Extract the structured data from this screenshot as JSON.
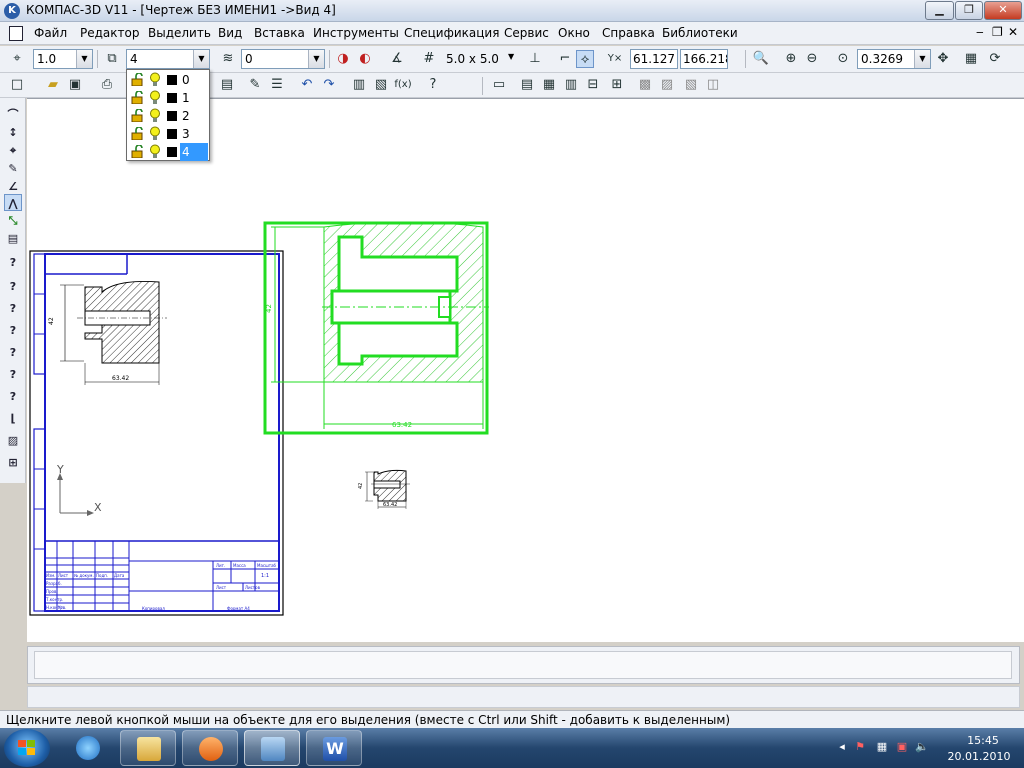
{
  "window": {
    "title": "КОМПАС-3D V11 - [Чертеж БЕЗ ИМЕНИ1 ->Вид 4]",
    "app_icon_letter": "K",
    "min_glyph": "▁",
    "max_glyph": "❐",
    "close_glyph": "✕"
  },
  "menu": {
    "items": [
      "Файл",
      "Редактор",
      "Выделить",
      "Вид",
      "Вставка",
      "Инструменты",
      "Спецификация",
      "Сервис",
      "Окно",
      "Справка",
      "Библиотеки"
    ],
    "mdi_minimize": "‒",
    "mdi_restore": "❐",
    "mdi_close": "✕"
  },
  "toolbar1": {
    "line_scale": "1.0",
    "current_layer": "4",
    "style_value": "0",
    "grid_step": "5.0 x 5.0",
    "coord_x": "61.127",
    "coord_y": "166.218",
    "zoom": "0.3269"
  },
  "layer_dropdown": {
    "layers": [
      {
        "num": "0",
        "selected": false
      },
      {
        "num": "1",
        "selected": false
      },
      {
        "num": "2",
        "selected": false
      },
      {
        "num": "3",
        "selected": false
      },
      {
        "num": "4",
        "selected": true
      }
    ]
  },
  "drawing": {
    "dim_width_label": "63.42",
    "dim_height_label": "42",
    "axis_x": "X",
    "axis_y": "Y",
    "view_dim_width": "63.42",
    "view_dim_height": "42",
    "small_dim_width": "63.42",
    "small_dim_height": "42",
    "stamp_texts": [
      "Изм.",
      "Лист",
      "№ докум.",
      "Подп.",
      "Дата",
      "Разраб.",
      "Пров.",
      "Т.контр.",
      "Н.контр.",
      "Утв.",
      "Лит.",
      "Масса",
      "Масштаб",
      "Лист",
      "Листов",
      "1:1",
      "Копировал",
      "Формат A4"
    ]
  },
  "status": {
    "hint": "Щелкните левой кнопкой мыши на объекте для его выделения (вместе с Ctrl или Shift - добавить к выделенным)"
  },
  "taskbar": {
    "time": "15:45",
    "date": "20.01.2010"
  },
  "colors": {
    "selection_green": "#22dd22",
    "sheet_blue": "#1a1acc",
    "hatch_green": "#38c838"
  }
}
